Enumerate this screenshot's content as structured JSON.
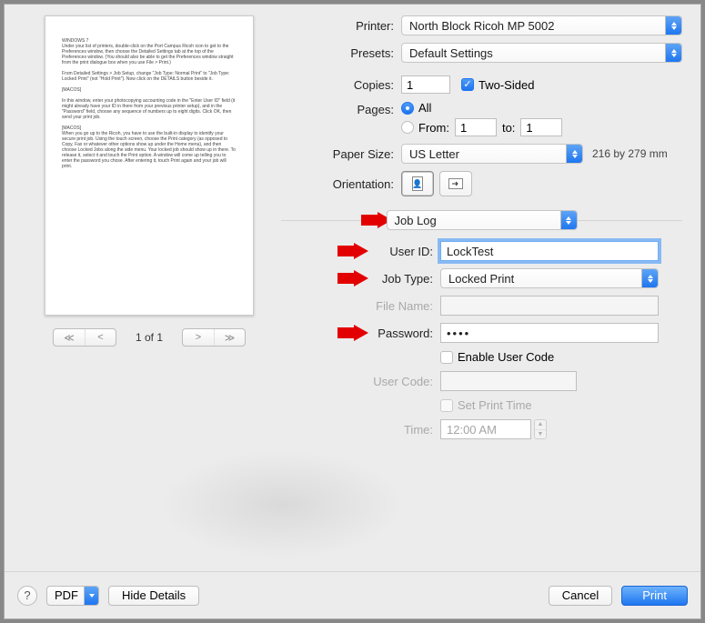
{
  "printer": {
    "label": "Printer:",
    "value": "North Block Ricoh MP 5002"
  },
  "presets": {
    "label": "Presets:",
    "value": "Default Settings"
  },
  "copies": {
    "label": "Copies:",
    "value": "1",
    "twosided_label": "Two-Sided",
    "twosided_checked": true
  },
  "pages": {
    "label": "Pages:",
    "all_label": "All",
    "from_label": "From:",
    "to_label": "to:",
    "from_value": "1",
    "to_value": "1",
    "selected": "all"
  },
  "paper": {
    "label": "Paper Size:",
    "value": "US Letter",
    "dimensions": "216 by 279 mm"
  },
  "orientation": {
    "label": "Orientation:"
  },
  "section_select": {
    "value": "Job Log"
  },
  "joblog": {
    "userid_label": "User ID:",
    "userid_value": "LockTest",
    "jobtype_label": "Job Type:",
    "jobtype_value": "Locked Print",
    "filename_label": "File Name:",
    "filename_value": "",
    "password_label": "Password:",
    "password_value": "••••",
    "enableusercode_label": "Enable User Code",
    "enableusercode_checked": false,
    "usercode_label": "User Code:",
    "usercode_value": "",
    "setprinttime_label": "Set Print Time",
    "setprinttime_checked": false,
    "time_label": "Time:",
    "time_value": "12:00 AM"
  },
  "preview_page_counter": "1 of 1",
  "footer": {
    "pdf_label": "PDF",
    "hide_details_label": "Hide Details",
    "cancel_label": "Cancel",
    "print_label": "Print",
    "help_symbol": "?"
  }
}
